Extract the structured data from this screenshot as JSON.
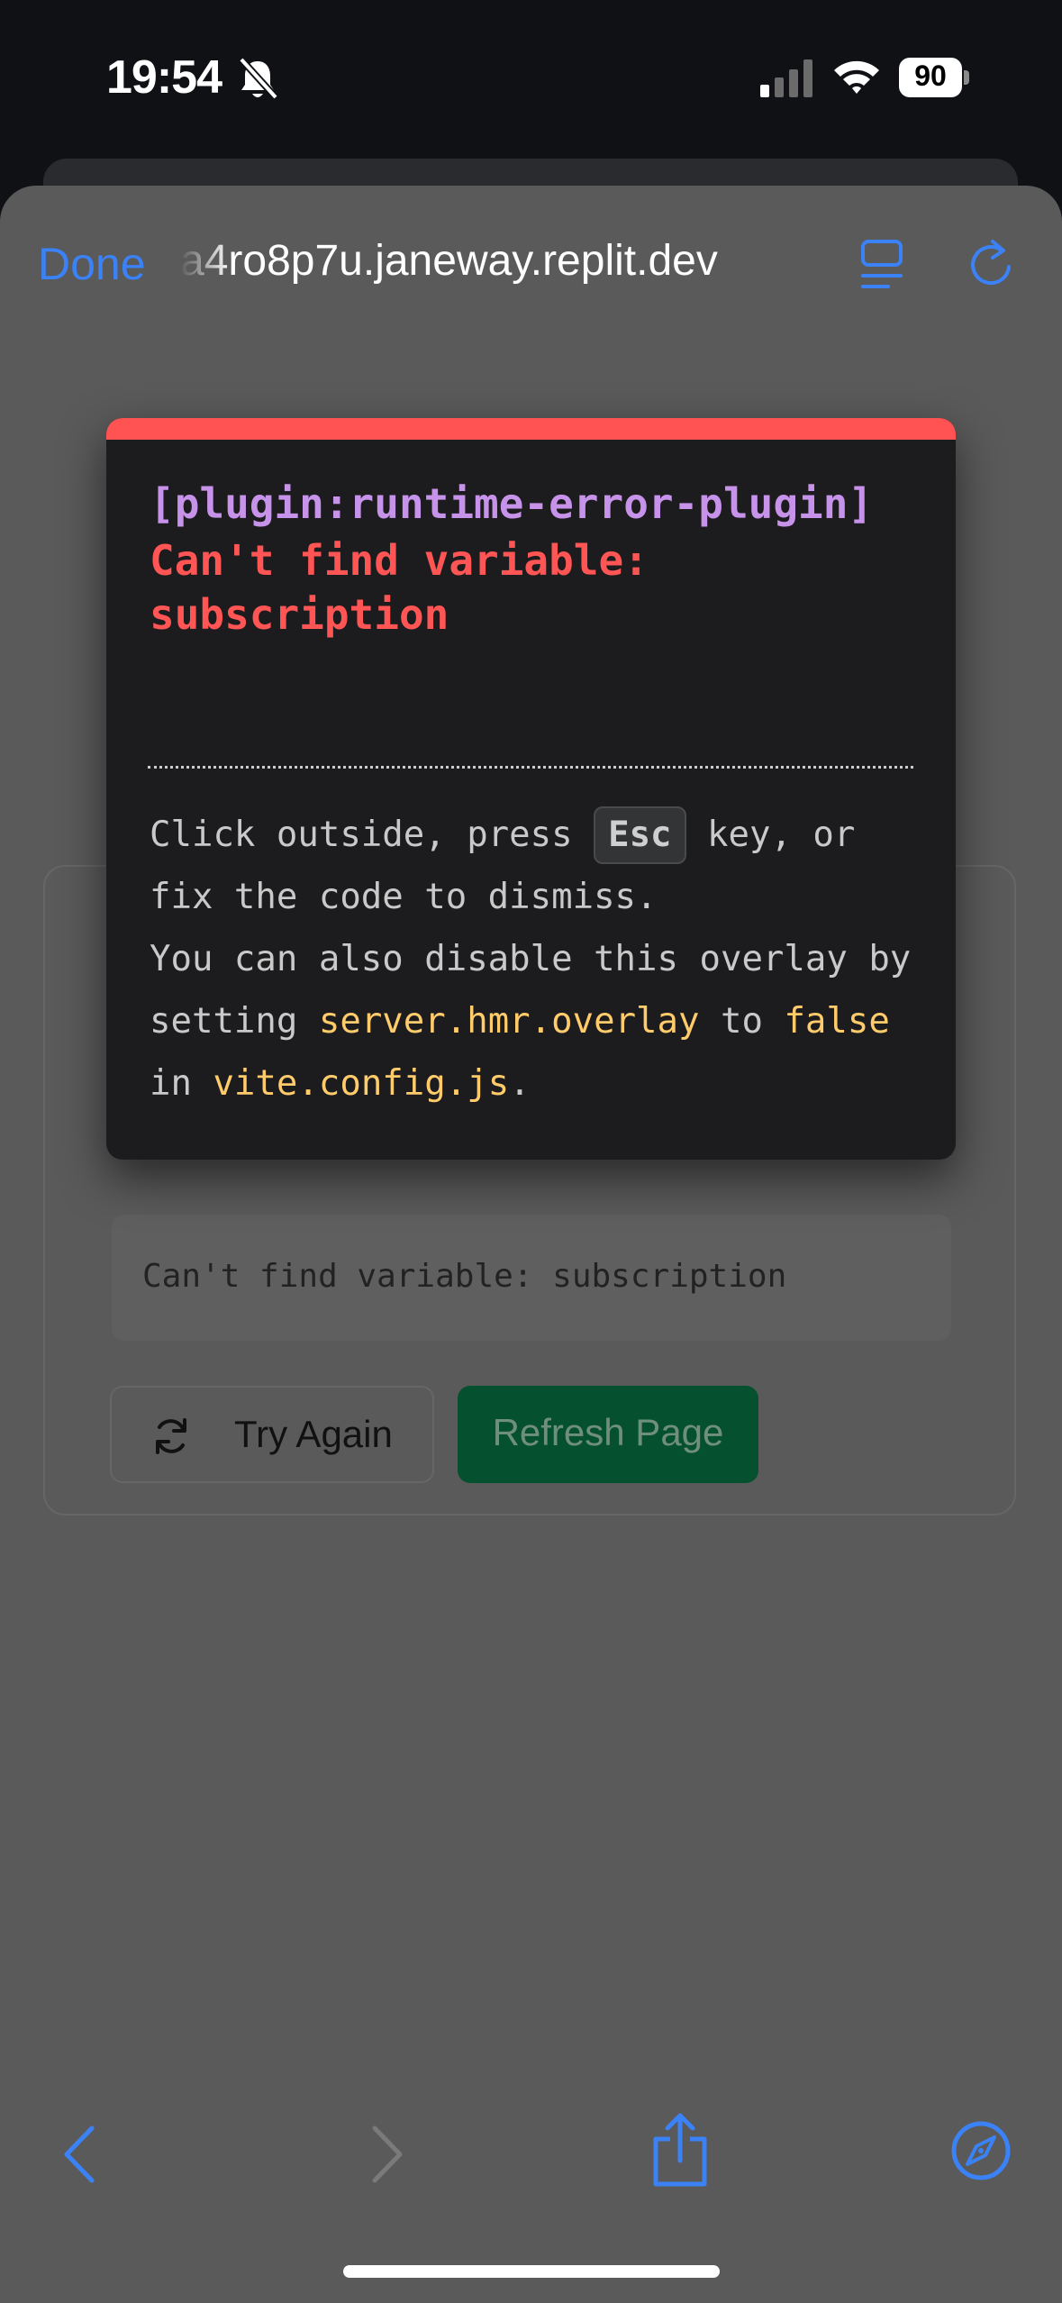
{
  "status_bar": {
    "time": "19:54",
    "battery": "90",
    "icons": [
      "bell-slash-icon",
      "signal-icon",
      "wifi-icon",
      "battery-icon"
    ]
  },
  "browser": {
    "done_label": "Done",
    "url": "a4ro8p7u.janeway.replit.dev",
    "accent_color": "#3b82f6"
  },
  "page": {
    "error_message": "Can't find variable: subscription",
    "try_again_label": "Try Again",
    "refresh_label": "Refresh Page"
  },
  "overlay": {
    "plugin": "[plugin:runtime-error-plugin]",
    "message": "Can't find variable: subscription",
    "tip_1": "Click outside, press",
    "key": "Esc",
    "tip_2": "key, or fix the code to dismiss.",
    "tip_3": "You can also disable this overlay by setting",
    "code_setting": "server.hmr.overlay",
    "tip_4": "to",
    "code_false": "false",
    "tip_5": "in",
    "code_file": "vite.config.js",
    "tip_6": ".",
    "accent_color": "#ff5252"
  },
  "toolbar": {
    "icons": [
      "back-icon",
      "forward-icon",
      "share-icon",
      "safari-compass-icon"
    ]
  }
}
